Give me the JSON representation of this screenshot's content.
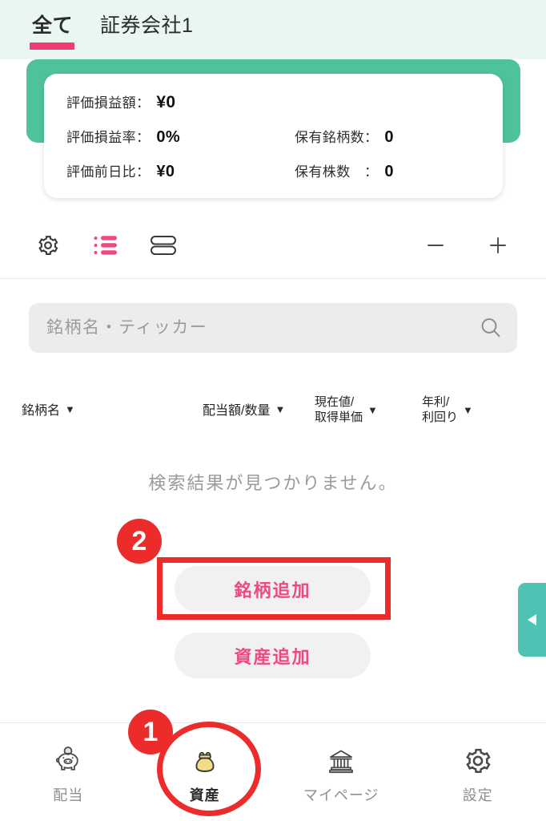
{
  "tabs": [
    {
      "label": "全て",
      "active": true
    },
    {
      "label": "証券会社1",
      "active": false
    }
  ],
  "summary": {
    "rows": [
      [
        {
          "label": "評価損益額：",
          "value": "¥0"
        }
      ],
      [
        {
          "label": "評価損益率：",
          "value": "0%"
        },
        {
          "label": "保有銘柄数：",
          "value": "0"
        }
      ],
      [
        {
          "label": "評価前日比：",
          "value": "¥0"
        },
        {
          "label": "保有株数　：",
          "value": "0"
        }
      ]
    ]
  },
  "toolbar": {
    "settings_icon": "gear-icon",
    "list_icon": "bullet-list-icon",
    "rows_icon": "two-rows-icon",
    "zoom_out_label": "−",
    "zoom_in_label": "+"
  },
  "search": {
    "placeholder": "銘柄名・ティッカー",
    "value": "",
    "icon": "search-icon"
  },
  "columns": [
    {
      "line1": "銘柄名",
      "line2": "",
      "caret": "▼"
    },
    {
      "line1": "配当額/数量",
      "line2": "",
      "caret": "▼"
    },
    {
      "line1": "現在値/",
      "line2": "取得単価",
      "caret": "▼"
    },
    {
      "line1": "年利/",
      "line2": "利回り",
      "caret": "▼"
    }
  ],
  "empty_state": {
    "message": "検索結果が見つかりません。"
  },
  "actions": {
    "add_stock_label": "銘柄追加",
    "add_asset_label": "資産追加"
  },
  "annotations": {
    "badge_one": "1",
    "badge_two": "2",
    "color": "#ec2b2b"
  },
  "drawer": {
    "handle_icon": "triangle-left-icon"
  },
  "bottom_nav": [
    {
      "label": "配当",
      "icon": "piggy-bank-icon",
      "active": false
    },
    {
      "label": "資産",
      "icon": "coin-purse-icon",
      "active": true
    },
    {
      "label": "マイページ",
      "icon": "bank-building-icon",
      "active": false
    },
    {
      "label": "設定",
      "icon": "gear-icon",
      "active": false
    }
  ],
  "colors": {
    "tabbar_bg": "#e9f6f1",
    "accent_pink": "#ef4a7f",
    "tab_underline": "#ef3d73",
    "green_band": "#4ec39a",
    "drawer_teal": "#4ec3b4",
    "annotation_red": "#ec2b2b",
    "purse_yellow": "#f2dc87"
  }
}
